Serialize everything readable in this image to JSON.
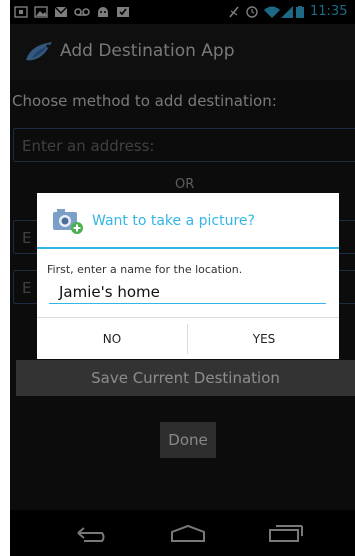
{
  "status_bar": {
    "time": "11:35",
    "notification_icons": [
      "calendar-icon",
      "gallery-icon",
      "gmail-icon",
      "voicemail-icon",
      "android-debug-icon",
      "download-done-icon"
    ],
    "system_icons": [
      "no-sim-icon",
      "alarm-icon",
      "wifi-icon",
      "signal-icon",
      "battery-icon"
    ]
  },
  "action_bar": {
    "app_title": "Add Destination App",
    "app_icon": "bird-icon"
  },
  "form": {
    "choose_label": "Choose method to add destination:",
    "address_placeholder": "Enter an address:",
    "or_label": "OR",
    "field_two_partial": "E",
    "field_three_partial": "E",
    "save_button": "Save Current Destination",
    "done_button": "Done"
  },
  "dialog": {
    "title": "Want to take a picture?",
    "icon": "camera-icon",
    "message": "First, enter a name for the location.",
    "name_value": "Jamie's home",
    "no_label": "NO",
    "yes_label": "YES"
  },
  "nav_bar": {
    "icons": [
      "back-icon",
      "home-icon",
      "recents-icon"
    ]
  },
  "colors": {
    "accent": "#33b5e5",
    "background": "#151515"
  }
}
